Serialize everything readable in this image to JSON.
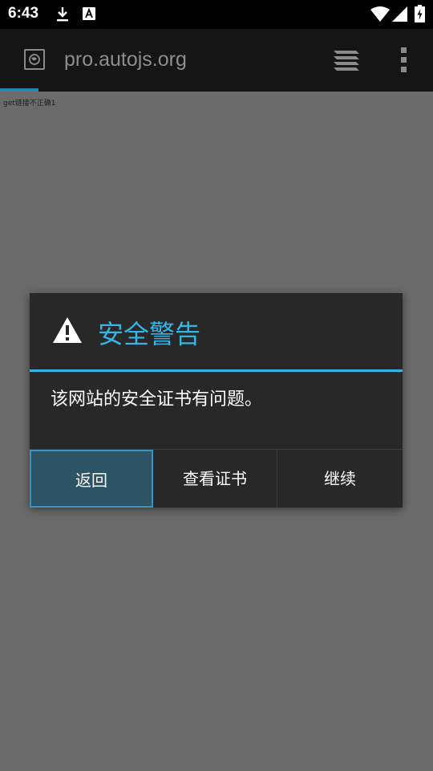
{
  "status_bar": {
    "time": "6:43"
  },
  "toolbar": {
    "url": "pro.autojs.org"
  },
  "page": {
    "text": "get链接不正确1"
  },
  "dialog": {
    "title": "安全警告",
    "message": "该网站的安全证书有问题。",
    "buttons": {
      "back": "返回",
      "view_certificate": "查看证书",
      "continue": "继续"
    }
  },
  "colors": {
    "accent": "#33b5e5",
    "background_dim": "#6b6b6b",
    "dialog_bg": "#282828",
    "pressed_button": "#2c5464"
  }
}
